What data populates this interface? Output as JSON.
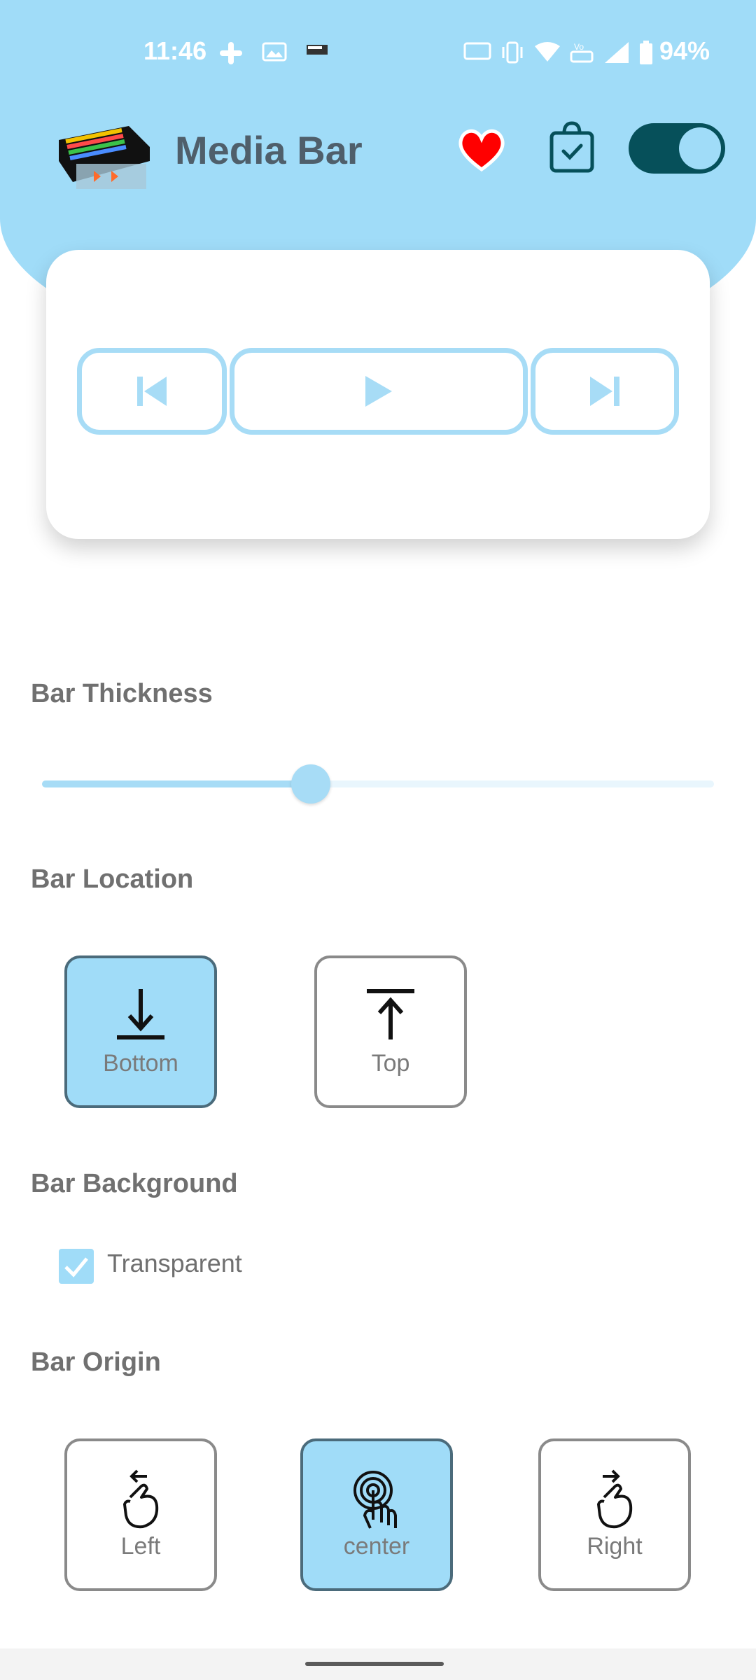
{
  "status_bar": {
    "time": "11:46",
    "battery": "94%"
  },
  "header": {
    "app_title": "Media Bar",
    "toggle_on": true
  },
  "player": {
    "prev_icon": "skip-previous-icon",
    "play_icon": "play-icon",
    "next_icon": "skip-next-icon"
  },
  "sections": {
    "thickness": "Bar Thickness",
    "location": "Bar Location",
    "background": "Bar Background",
    "origin": "Bar Origin"
  },
  "thickness_slider": {
    "value": 0.4
  },
  "location_options": [
    {
      "label": "Bottom",
      "selected": true
    },
    {
      "label": "Top",
      "selected": false
    }
  ],
  "background": {
    "transparent_label": "Transparent",
    "transparent_checked": true
  },
  "origin_options": [
    {
      "label": "Left",
      "selected": false
    },
    {
      "label": "center",
      "selected": true
    },
    {
      "label": "Right",
      "selected": false
    }
  ],
  "colors": {
    "accent": "#a0dcf8",
    "toggle_dark": "#06505a",
    "heart": "#ff0000"
  }
}
